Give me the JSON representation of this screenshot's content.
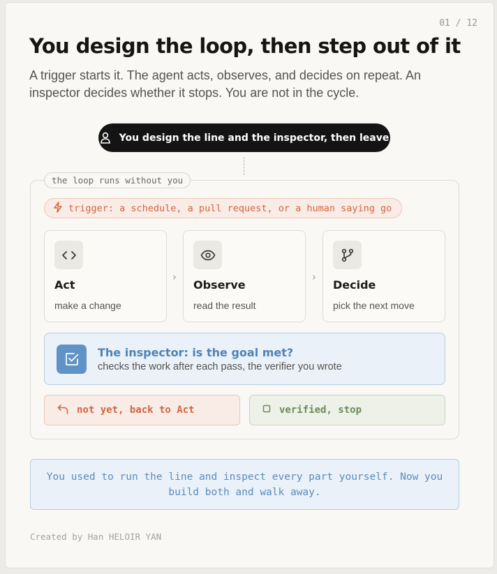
{
  "page_counter": "01 / 12",
  "title": "You design the loop, then step out of it",
  "subtitle": "A trigger starts it. The agent acts, observes, and decides on repeat. An inspector decides whether it stops. You are not in the cycle.",
  "designer": {
    "icon": "person-icon",
    "label": "You design the line and the inspector, then leave"
  },
  "loop": {
    "label": "the loop runs without you",
    "trigger": {
      "icon": "lightning-icon",
      "label": "trigger: a schedule, a pull request, or a human saying go"
    },
    "steps": [
      {
        "icon": "code-icon",
        "title": "Act",
        "desc": "make a change"
      },
      {
        "icon": "eye-icon",
        "title": "Observe",
        "desc": "read the result"
      },
      {
        "icon": "git-branch-icon",
        "title": "Decide",
        "desc": "pick the next move"
      }
    ],
    "arrow_glyph": "›",
    "inspector": {
      "icon": "checkbox-edit-icon",
      "title": "The inspector: is the goal met?",
      "desc": "checks the work after each pass, the verifier you wrote"
    },
    "outcomes": {
      "retry": {
        "icon": "return-arrow-icon",
        "label": "not yet, back to Act"
      },
      "stop": {
        "icon": "square-icon",
        "label": "verified, stop"
      }
    }
  },
  "summary": "You used to run the line and inspect every part yourself. Now you build both and walk away.",
  "credit": "Created by Han HELOIR YAN",
  "colors": {
    "accent_orange": "#d1663f",
    "accent_blue": "#5f93c5",
    "accent_green": "#6e8a5c",
    "pill_dark": "#141414"
  }
}
